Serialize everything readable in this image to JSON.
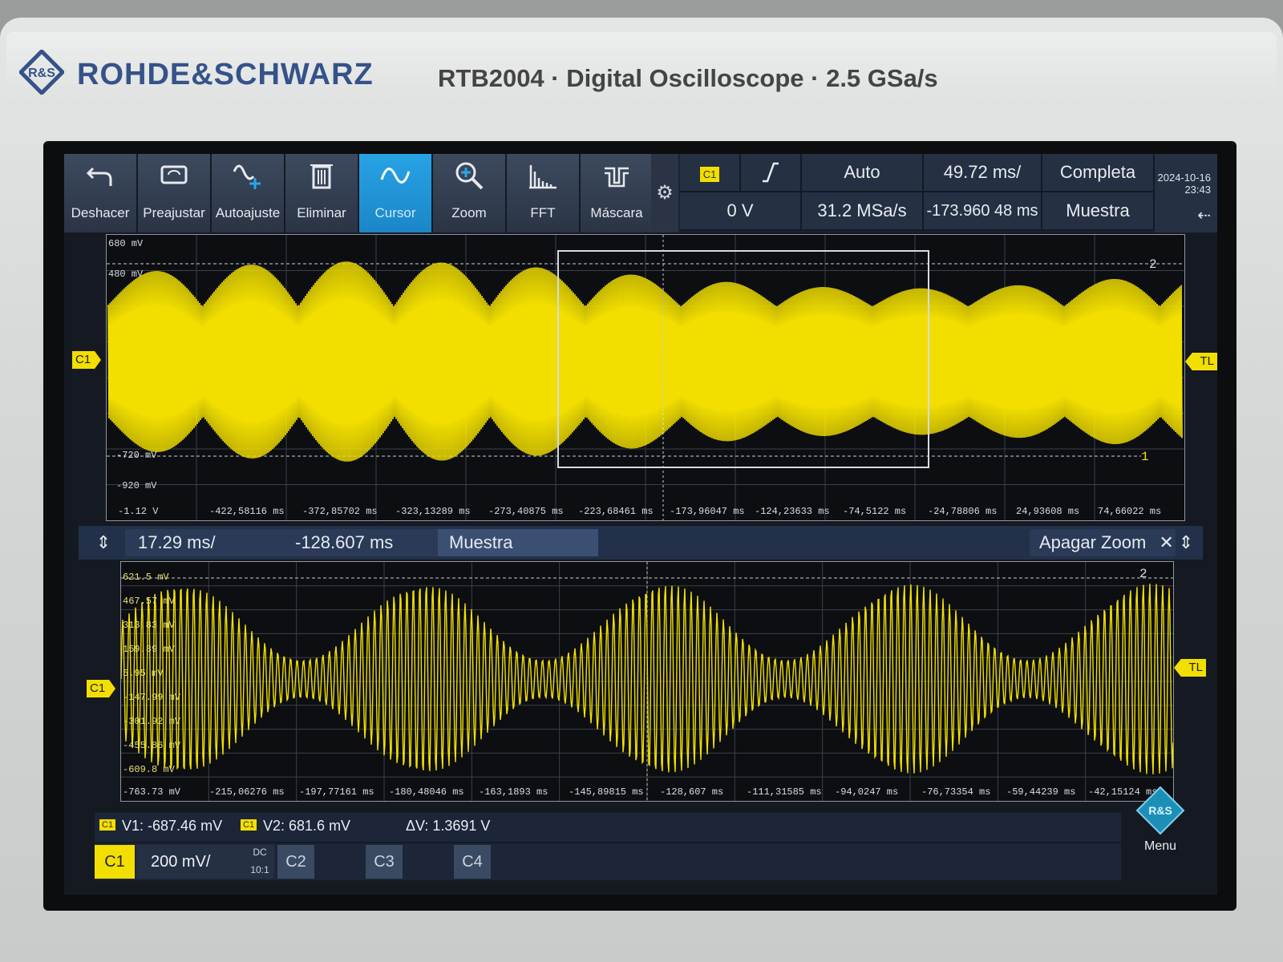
{
  "brand": {
    "name": "ROHDE&SCHWARZ",
    "model_line": "RTB2004 · Digital Oscilloscope · 2.5 GSa/s"
  },
  "toolbar": {
    "tools": [
      {
        "label": "Deshacer",
        "icon": "undo-icon"
      },
      {
        "label": "Preajustar",
        "icon": "preset-icon"
      },
      {
        "label": "Autoajuste",
        "icon": "autoset-icon"
      },
      {
        "label": "Eliminar",
        "icon": "trash-icon"
      },
      {
        "label": "Cursor",
        "icon": "cursor-wave-icon",
        "active": true
      },
      {
        "label": "Zoom",
        "icon": "magnifier-icon"
      },
      {
        "label": "FFT",
        "icon": "fft-icon"
      },
      {
        "label": "Máscara",
        "icon": "mask-icon"
      }
    ],
    "trigger_source": "C1",
    "trigger_level": "0 V",
    "trigger_mode": "Auto",
    "sample_rate": "31.2 MSa/s",
    "timebase": "49.72 ms/",
    "position": "-173.960 48 ms",
    "acq_mode": "Completa",
    "acq_type": "Muestra",
    "date": "2024-10-16",
    "time": "23:43"
  },
  "main_plot": {
    "levels": [
      "680 mV",
      "480 mV",
      "-720 mV",
      "-920 mV",
      "-1.12 V"
    ],
    "time_ticks": [
      "-422,58116 ms",
      "-372,85702 ms",
      "-323,13289 ms",
      "-273,40875 ms",
      "-223,68461 ms",
      "-173,96047 ms",
      "-124,23633 ms",
      "-74,5122 ms",
      "-24,78806 ms",
      "24,93608 ms",
      "74,66022 ms"
    ],
    "cursor_labels": [
      "2",
      "1"
    ],
    "channel_marker": "C1",
    "trigger_marker": "TL"
  },
  "zoom_bar": {
    "timebase": "17.29 ms/",
    "position": "-128.607 ms",
    "acq_type": "Muestra",
    "zoom_off": "Apagar Zoom"
  },
  "zoom_plot": {
    "levels": [
      "621.5 mV",
      "467.57 mV",
      "313.83 mV",
      "159.89 mV",
      "5.95 mV",
      "-147.99 mV",
      "-301.92 mV",
      "-455.86 mV",
      "-609.8 mV",
      "-763.73 mV"
    ],
    "time_ticks": [
      "-215,06276 ms",
      "-197,77161 ms",
      "-180,48046 ms",
      "-163,1893 ms",
      "-145,89815 ms",
      "-128,607 ms",
      "-111,31585 ms",
      "-94,0247 ms",
      "-76,73354 ms",
      "-59,44239 ms",
      "-42,15124 ms"
    ],
    "cursor_labels": [
      "2"
    ],
    "channel_marker": "C1",
    "trigger_marker": "TL"
  },
  "cursor_readout": {
    "v1_source": "C1",
    "v1": "V1: -687.46 mV",
    "v2_source": "C1",
    "v2": "V2: 681.6 mV",
    "delta": "ΔV: 1.3691 V"
  },
  "channels": {
    "c1": {
      "label": "C1",
      "scale": "200 mV/",
      "coupling": "DC",
      "probe": "10:1"
    },
    "c2": {
      "label": "C2"
    },
    "c3": {
      "label": "C3"
    },
    "c4": {
      "label": "C4"
    }
  },
  "menu": {
    "label": "Menu"
  },
  "colors": {
    "trace": "#f2df00",
    "accent": "#1b86c7",
    "brand": "#35538a"
  }
}
